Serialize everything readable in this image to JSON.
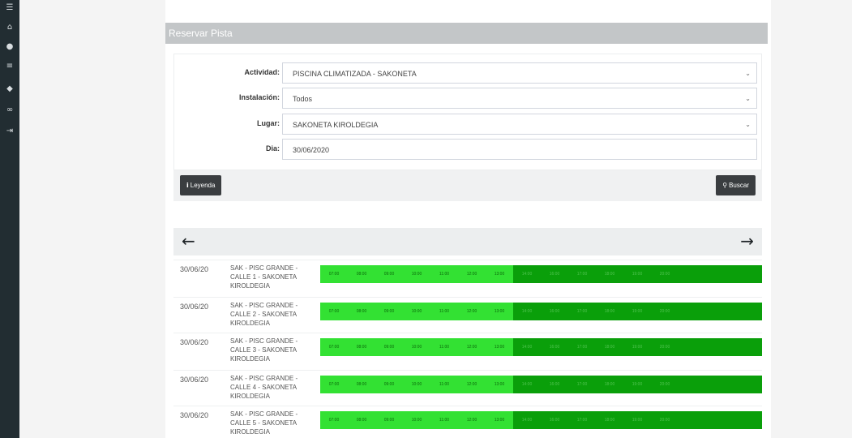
{
  "sidebar": {
    "icons": [
      {
        "name": "menu-icon",
        "glyph": "☰"
      },
      {
        "name": "home-icon",
        "glyph": "⌂"
      },
      {
        "name": "user-icon",
        "glyph": "●"
      },
      {
        "name": "list-icon",
        "glyph": "≡"
      },
      {
        "name": "tag-icon",
        "glyph": "◆"
      },
      {
        "name": "link-icon",
        "glyph": "∞"
      },
      {
        "name": "logout-icon",
        "glyph": "⇥"
      }
    ]
  },
  "header": {
    "title": "Reservar Pista"
  },
  "form": {
    "actividad": {
      "label": "Actividad:",
      "value": "PISCINA CLIMATIZADA - SAKONETA"
    },
    "instalacion": {
      "label": "Instalación:",
      "value": "Todos"
    },
    "lugar": {
      "label": "Lugar:",
      "value": "SAKONETA KIROLDEGIA"
    },
    "dia": {
      "label": "Dia:",
      "value": "30/06/2020"
    }
  },
  "actions": {
    "leyenda_label": "Leyenda",
    "buscar_label": "Buscar"
  },
  "nav": {
    "prev_glyph": "←",
    "next_glyph": "→"
  },
  "schedule": {
    "times_light": [
      "07:00",
      "08:00",
      "09:00",
      "10:00",
      "11:00",
      "12:00",
      "13:00"
    ],
    "times_dark": [
      "14:00",
      "16:00",
      "17:00",
      "18:00",
      "19:00",
      "20:00"
    ],
    "colors": {
      "available": "#33e133",
      "available_dark": "#0a9f0a"
    },
    "rows": [
      {
        "date": "30/06/20",
        "place": "SAK - PISC GRANDE - CALLE 1 - SAKONETA KIROLDEGIA"
      },
      {
        "date": "30/06/20",
        "place": "SAK - PISC GRANDE - CALLE 2 - SAKONETA KIROLDEGIA"
      },
      {
        "date": "30/06/20",
        "place": "SAK - PISC GRANDE - CALLE 3 - SAKONETA KIROLDEGIA"
      },
      {
        "date": "30/06/20",
        "place": "SAK - PISC GRANDE - CALLE 4 - SAKONETA KIROLDEGIA"
      },
      {
        "date": "30/06/20",
        "place": "SAK - PISC GRANDE - CALLE 5 - SAKONETA KIROLDEGIA"
      }
    ]
  }
}
